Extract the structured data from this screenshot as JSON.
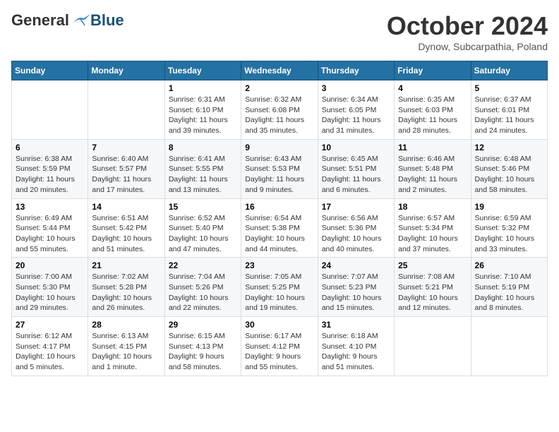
{
  "logo": {
    "general": "General",
    "blue": "Blue"
  },
  "header": {
    "month": "October 2024",
    "location": "Dynow, Subcarpathia, Poland"
  },
  "weekdays": [
    "Sunday",
    "Monday",
    "Tuesday",
    "Wednesday",
    "Thursday",
    "Friday",
    "Saturday"
  ],
  "weeks": [
    [
      {
        "day": "",
        "info": ""
      },
      {
        "day": "",
        "info": ""
      },
      {
        "day": "1",
        "info": "Sunrise: 6:31 AM\nSunset: 6:10 PM\nDaylight: 11 hours and 39 minutes."
      },
      {
        "day": "2",
        "info": "Sunrise: 6:32 AM\nSunset: 6:08 PM\nDaylight: 11 hours and 35 minutes."
      },
      {
        "day": "3",
        "info": "Sunrise: 6:34 AM\nSunset: 6:05 PM\nDaylight: 11 hours and 31 minutes."
      },
      {
        "day": "4",
        "info": "Sunrise: 6:35 AM\nSunset: 6:03 PM\nDaylight: 11 hours and 28 minutes."
      },
      {
        "day": "5",
        "info": "Sunrise: 6:37 AM\nSunset: 6:01 PM\nDaylight: 11 hours and 24 minutes."
      }
    ],
    [
      {
        "day": "6",
        "info": "Sunrise: 6:38 AM\nSunset: 5:59 PM\nDaylight: 11 hours and 20 minutes."
      },
      {
        "day": "7",
        "info": "Sunrise: 6:40 AM\nSunset: 5:57 PM\nDaylight: 11 hours and 17 minutes."
      },
      {
        "day": "8",
        "info": "Sunrise: 6:41 AM\nSunset: 5:55 PM\nDaylight: 11 hours and 13 minutes."
      },
      {
        "day": "9",
        "info": "Sunrise: 6:43 AM\nSunset: 5:53 PM\nDaylight: 11 hours and 9 minutes."
      },
      {
        "day": "10",
        "info": "Sunrise: 6:45 AM\nSunset: 5:51 PM\nDaylight: 11 hours and 6 minutes."
      },
      {
        "day": "11",
        "info": "Sunrise: 6:46 AM\nSunset: 5:48 PM\nDaylight: 11 hours and 2 minutes."
      },
      {
        "day": "12",
        "info": "Sunrise: 6:48 AM\nSunset: 5:46 PM\nDaylight: 10 hours and 58 minutes."
      }
    ],
    [
      {
        "day": "13",
        "info": "Sunrise: 6:49 AM\nSunset: 5:44 PM\nDaylight: 10 hours and 55 minutes."
      },
      {
        "day": "14",
        "info": "Sunrise: 6:51 AM\nSunset: 5:42 PM\nDaylight: 10 hours and 51 minutes."
      },
      {
        "day": "15",
        "info": "Sunrise: 6:52 AM\nSunset: 5:40 PM\nDaylight: 10 hours and 47 minutes."
      },
      {
        "day": "16",
        "info": "Sunrise: 6:54 AM\nSunset: 5:38 PM\nDaylight: 10 hours and 44 minutes."
      },
      {
        "day": "17",
        "info": "Sunrise: 6:56 AM\nSunset: 5:36 PM\nDaylight: 10 hours and 40 minutes."
      },
      {
        "day": "18",
        "info": "Sunrise: 6:57 AM\nSunset: 5:34 PM\nDaylight: 10 hours and 37 minutes."
      },
      {
        "day": "19",
        "info": "Sunrise: 6:59 AM\nSunset: 5:32 PM\nDaylight: 10 hours and 33 minutes."
      }
    ],
    [
      {
        "day": "20",
        "info": "Sunrise: 7:00 AM\nSunset: 5:30 PM\nDaylight: 10 hours and 29 minutes."
      },
      {
        "day": "21",
        "info": "Sunrise: 7:02 AM\nSunset: 5:28 PM\nDaylight: 10 hours and 26 minutes."
      },
      {
        "day": "22",
        "info": "Sunrise: 7:04 AM\nSunset: 5:26 PM\nDaylight: 10 hours and 22 minutes."
      },
      {
        "day": "23",
        "info": "Sunrise: 7:05 AM\nSunset: 5:25 PM\nDaylight: 10 hours and 19 minutes."
      },
      {
        "day": "24",
        "info": "Sunrise: 7:07 AM\nSunset: 5:23 PM\nDaylight: 10 hours and 15 minutes."
      },
      {
        "day": "25",
        "info": "Sunrise: 7:08 AM\nSunset: 5:21 PM\nDaylight: 10 hours and 12 minutes."
      },
      {
        "day": "26",
        "info": "Sunrise: 7:10 AM\nSunset: 5:19 PM\nDaylight: 10 hours and 8 minutes."
      }
    ],
    [
      {
        "day": "27",
        "info": "Sunrise: 6:12 AM\nSunset: 4:17 PM\nDaylight: 10 hours and 5 minutes."
      },
      {
        "day": "28",
        "info": "Sunrise: 6:13 AM\nSunset: 4:15 PM\nDaylight: 10 hours and 1 minute."
      },
      {
        "day": "29",
        "info": "Sunrise: 6:15 AM\nSunset: 4:13 PM\nDaylight: 9 hours and 58 minutes."
      },
      {
        "day": "30",
        "info": "Sunrise: 6:17 AM\nSunset: 4:12 PM\nDaylight: 9 hours and 55 minutes."
      },
      {
        "day": "31",
        "info": "Sunrise: 6:18 AM\nSunset: 4:10 PM\nDaylight: 9 hours and 51 minutes."
      },
      {
        "day": "",
        "info": ""
      },
      {
        "day": "",
        "info": ""
      }
    ]
  ]
}
